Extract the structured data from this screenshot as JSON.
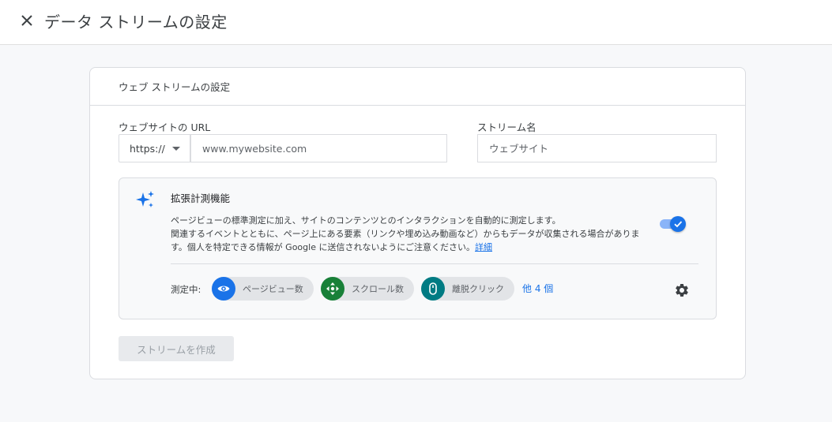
{
  "header": {
    "title": "データ ストリームの設定",
    "close_icon": "close-icon"
  },
  "card": {
    "title": "ウェブ ストリームの設定",
    "website_url": {
      "label": "ウェブサイトの URL",
      "protocol": "https://",
      "placeholder": "www.mywebsite.com"
    },
    "stream_name": {
      "label": "ストリーム名",
      "placeholder": "ウェブサイト"
    },
    "enhanced_measurement": {
      "title": "拡張計測機能",
      "description_line1": "ページビューの標準測定に加え、サイトのコンテンツとのインタラクションを自動的に測定します。",
      "description_line2": "関連するイベントとともに、ページ上にある要素（リンクや埋め込み動画など）からもデータが収集される場合がありま",
      "description_line3": "す。個人を特定できる情報が Google に送信されないようにご注意ください。",
      "details_link": "詳細",
      "enabled": true,
      "measuring_label": "測定中:",
      "chips": [
        {
          "label": "ページビュー数",
          "icon": "eye-icon",
          "color": "#1a73e8"
        },
        {
          "label": "スクロール数",
          "icon": "scroll-arrows-icon",
          "color": "#188038"
        },
        {
          "label": "離脱クリック",
          "icon": "mouse-icon",
          "color": "#007b83"
        }
      ],
      "more_link": "他 4 個"
    },
    "create_button": "ストリームを作成"
  },
  "colors": {
    "accent": "#1a73e8",
    "background": "#f7f8fa"
  }
}
